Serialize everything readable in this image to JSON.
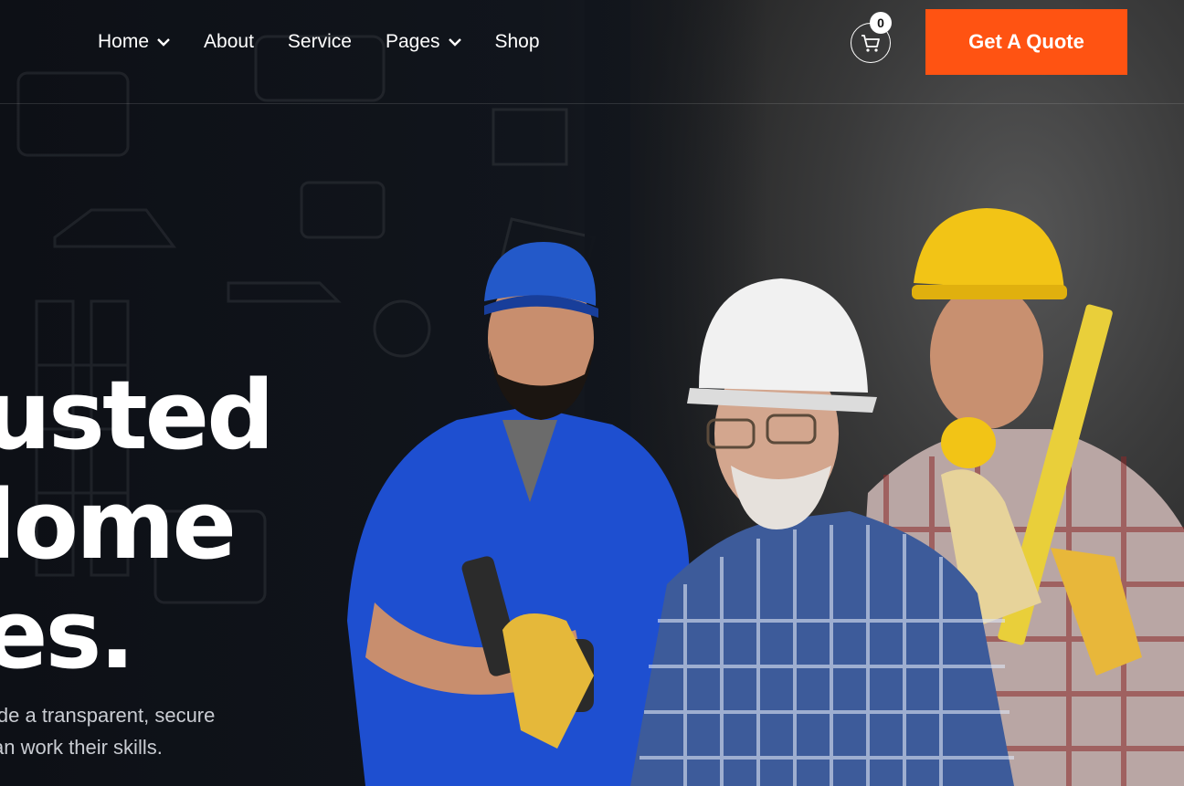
{
  "nav": {
    "items": [
      {
        "label": "Home",
        "dropdown": true
      },
      {
        "label": "About",
        "dropdown": false
      },
      {
        "label": "Service",
        "dropdown": false
      },
      {
        "label": "Pages",
        "dropdown": true
      },
      {
        "label": "Shop",
        "dropdown": false
      }
    ]
  },
  "cart": {
    "count": "0",
    "icon": "cart-icon"
  },
  "cta": {
    "label": "Get A Quote",
    "color": "#ff5312"
  },
  "hero": {
    "headline_lines": [
      "usted",
      "lome",
      "es."
    ],
    "subtext_lines": [
      "ide a transparent, secure",
      "an work their skills."
    ]
  }
}
